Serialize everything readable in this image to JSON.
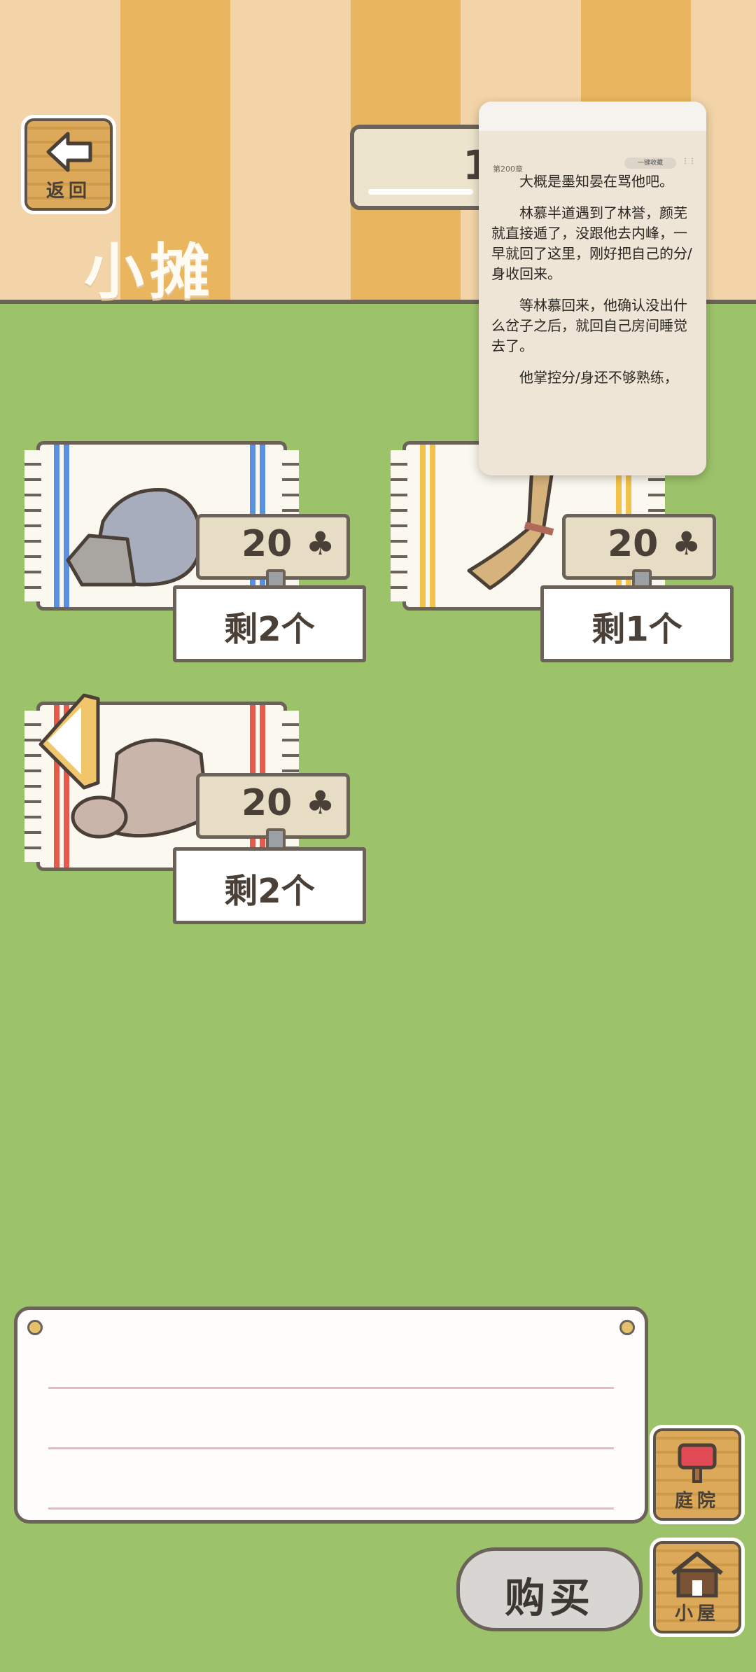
{
  "header": {
    "back_label": "返回",
    "title": "小摊",
    "counter_value": "1"
  },
  "reader": {
    "chapter": "第200章",
    "pill": "一键收藏",
    "paragraphs": [
      "大概是墨知晏在骂他吧。",
      "林慕半道遇到了林誉，颜芜就直接遁了，没跟他去内峰，一早就回了这里，刚好把自己的分/身收回来。",
      "等林慕回来，他确认没出什么岔子之后，就回自己房间睡觉去了。",
      "他掌控分/身还不够熟练，"
    ]
  },
  "items": [
    {
      "price": "20",
      "currency_icon": "clover-icon",
      "stock": "剩2个",
      "item": "rock",
      "stripe_color": "#5b8fe0"
    },
    {
      "price": "20",
      "currency_icon": "clover-icon",
      "stock": "剩1个",
      "item": "straw-broom",
      "stripe_color": "#f2c24a"
    },
    {
      "price": "20",
      "currency_icon": "clover-icon",
      "stock": "剩2个",
      "item": "cloth-roll",
      "stripe_color": "#e55a4a"
    }
  ],
  "nav": {
    "yard_label": "庭院",
    "house_label": "小屋",
    "buy_label": "购买"
  },
  "colors": {
    "grass": "#9dc36a",
    "wall_light": "#f3d4a8",
    "wall_dark": "#e9b55e",
    "outline": "#6b6259"
  }
}
